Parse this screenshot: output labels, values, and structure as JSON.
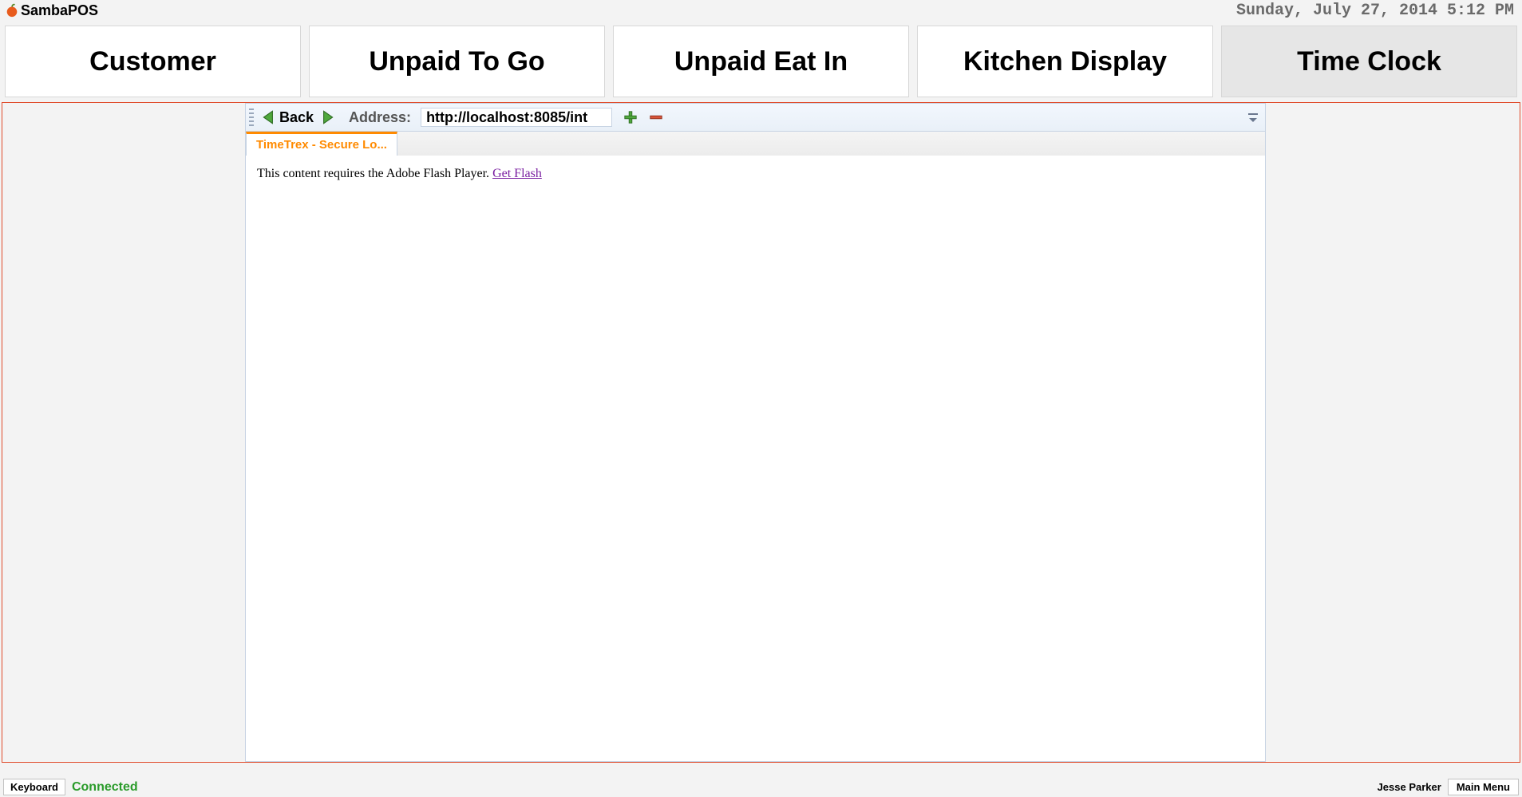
{
  "header": {
    "app_name": "SambaPOS",
    "datetime": "Sunday, July 27, 2014 5:12 PM"
  },
  "nav": {
    "tabs": [
      {
        "label": "Customer",
        "active": false
      },
      {
        "label": "Unpaid To Go",
        "active": false
      },
      {
        "label": "Unpaid Eat In",
        "active": false
      },
      {
        "label": "Kitchen Display",
        "active": false
      },
      {
        "label": "Time Clock",
        "active": true
      }
    ]
  },
  "browser": {
    "back_label": "Back",
    "address_label": "Address:",
    "address_value": "http://localhost:8085/int",
    "tab_title": "TimeTrex - Secure Lo...",
    "content_text": "This content requires the Adobe Flash Player. ",
    "content_link": "Get Flash"
  },
  "footer": {
    "keyboard": "Keyboard",
    "status": "Connected",
    "user": "Jesse Parker",
    "menu": "Main Menu"
  }
}
